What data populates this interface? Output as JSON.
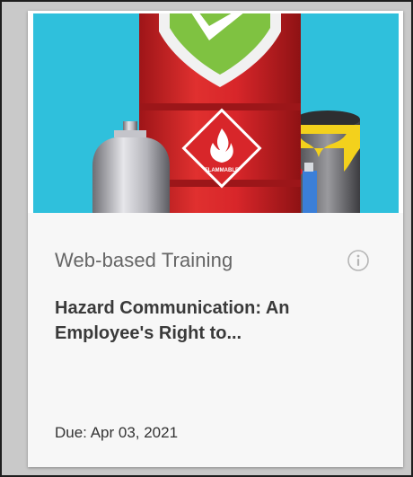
{
  "card": {
    "course_type": "Web-based Training",
    "title": "Hazard Communication: An Employee's Right to...",
    "due_label": "Due: Apr 03, 2021",
    "thumbnail_label_text": "FLAMMABLE",
    "info_icon": "info-circle-icon"
  },
  "colors": {
    "thumb_background": "#2fc0dc",
    "barrel_red": "#d8262a",
    "check_green": "#7fc241",
    "card_body": "#f7f7f7"
  }
}
